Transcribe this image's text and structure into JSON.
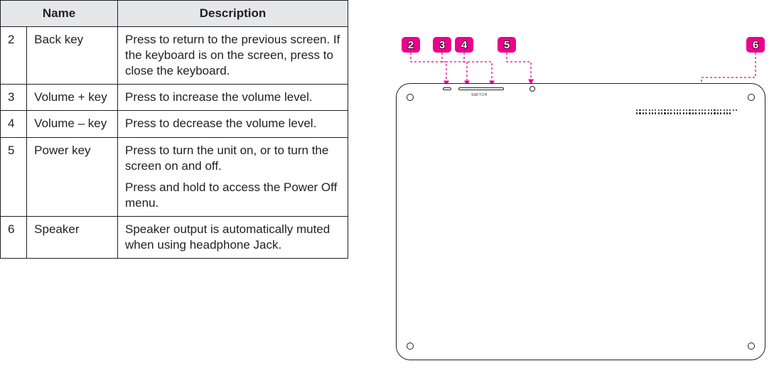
{
  "table": {
    "headers": {
      "name": "Name",
      "description": "Description"
    },
    "rows": [
      {
        "num": "2",
        "name": "Back key",
        "desc": [
          "Press to return to the previous screen. If the keyboard is on the screen, press to close the keyboard."
        ]
      },
      {
        "num": "3",
        "name": "Volume + key",
        "desc": [
          "Press to increase the volume level."
        ]
      },
      {
        "num": "4",
        "name": "Volume – key",
        "desc": [
          "Press to decrease the volume level."
        ]
      },
      {
        "num": "5",
        "name": "Power key",
        "desc": [
          "Press to turn the unit on, or to turn the screen on and off.",
          "Press and hold to access the Power Off menu."
        ]
      },
      {
        "num": "6",
        "name": "Speaker",
        "desc": [
          "Speaker output is automatically muted when using headphone Jack."
        ]
      }
    ]
  },
  "diagram": {
    "switch_text": "SWITCH",
    "callouts": {
      "c2": "2",
      "c3": "3",
      "c4": "4",
      "c5": "5",
      "c6": "6"
    }
  }
}
